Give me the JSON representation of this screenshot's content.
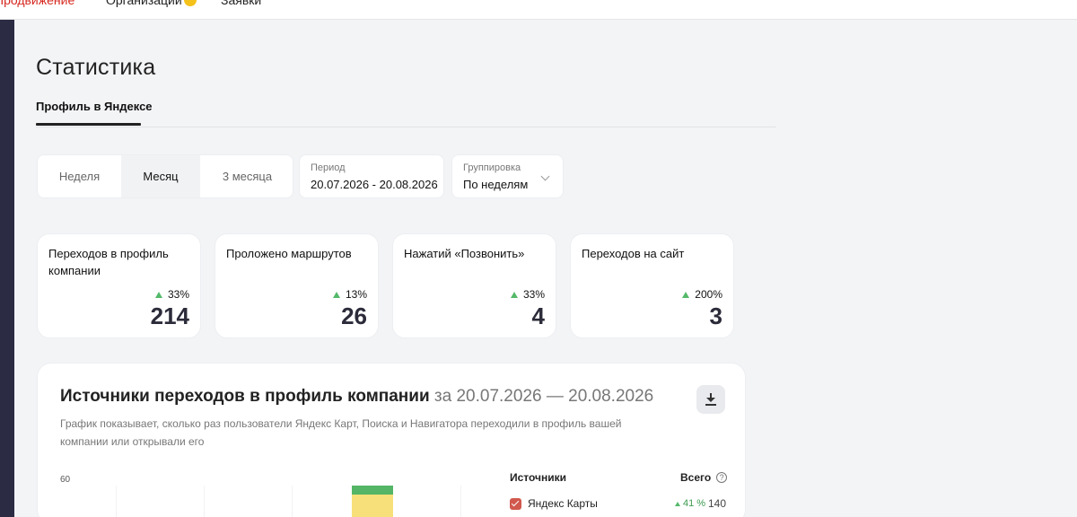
{
  "topnav": {
    "items": [
      {
        "label": "Продвижение"
      },
      {
        "label": "Организации"
      },
      {
        "label": "Заявки"
      }
    ]
  },
  "page": {
    "title": "Статистика",
    "tab": "Профиль в Яндексе"
  },
  "filters": {
    "segments": [
      "Неделя",
      "Месяц",
      "3 месяца"
    ],
    "selected_segment": "Месяц",
    "period_label": "Период",
    "period_value": "20.07.2026 - 20.08.2026",
    "grouping_label": "Группировка",
    "grouping_value": "По неделям"
  },
  "colors": {
    "accent_red": "#d6281f",
    "up_green": "#54b96a",
    "sidebar_dark": "#2b2b44"
  },
  "metrics": [
    {
      "title": "Переходов в профиль компании",
      "delta": "33%",
      "value": "214"
    },
    {
      "title": "Проложено маршрутов",
      "delta": "13%",
      "value": "26"
    },
    {
      "title": "Нажатий «Позвонить»",
      "delta": "33%",
      "value": "4"
    },
    {
      "title": "Переходов на сайт",
      "delta": "200%",
      "value": "3"
    }
  ],
  "sources": {
    "title": "Источники переходов в профиль компании",
    "range": "за 20.07.2026 — 20.08.2026",
    "description": "График показывает, сколько раз пользователи Яндекс Карт, Поиска и Навигатора переходили в профиль вашей компании или открывали его",
    "download_icon": "download-icon",
    "chart": {
      "y_tick": "60"
    },
    "table": {
      "col_sources": "Источники",
      "col_total": "Всего",
      "help_icon": "question-circle-icon",
      "rows": [
        {
          "name": "Яндекс Карты",
          "delta": "41 %",
          "total": "140",
          "checked": true
        }
      ]
    }
  }
}
